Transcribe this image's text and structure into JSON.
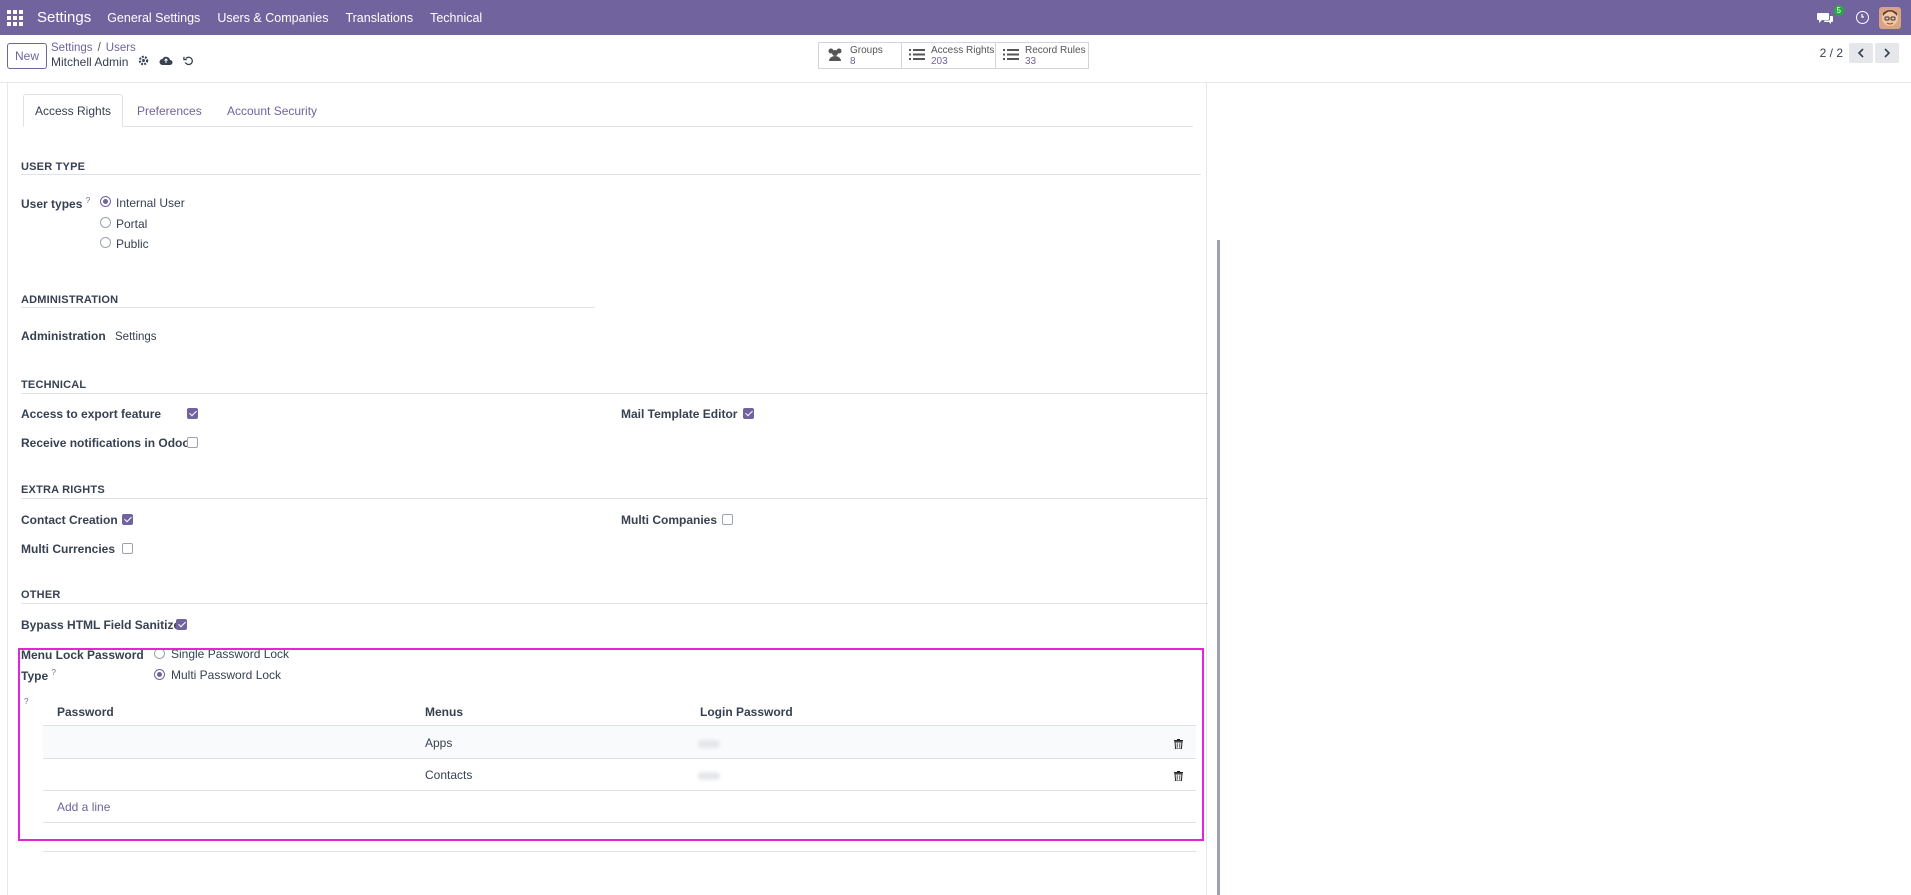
{
  "navbar": {
    "brand": "Settings",
    "menu": [
      "General Settings",
      "Users & Companies",
      "Translations",
      "Technical"
    ],
    "chat_count": "5"
  },
  "control_panel": {
    "new_label": "New",
    "breadcrumb": [
      "Settings",
      "Users"
    ],
    "record_name": "Mitchell Admin",
    "stats": [
      {
        "label": "Groups",
        "value": "8"
      },
      {
        "label": "Access Rights",
        "value": "203"
      },
      {
        "label": "Record Rules",
        "value": "33"
      }
    ],
    "pager": "2 / 2"
  },
  "tabs": [
    "Access Rights",
    "Preferences",
    "Account Security"
  ],
  "sections": {
    "user_type": {
      "title": "USER TYPE",
      "label": "User types",
      "options": [
        "Internal User",
        "Portal",
        "Public"
      ],
      "selected": "Internal User"
    },
    "administration": {
      "title": "ADMINISTRATION",
      "label": "Administration",
      "value": "Settings"
    },
    "technical": {
      "title": "TECHNICAL",
      "export": "Access to export feature",
      "notifications": "Receive notifications in Odoo",
      "mail_template": "Mail Template Editor"
    },
    "extra_rights": {
      "title": "EXTRA RIGHTS",
      "contact_creation": "Contact Creation",
      "multi_currencies": "Multi Currencies",
      "multi_companies": "Multi Companies"
    },
    "other": {
      "title": "OTHER",
      "bypass": "Bypass HTML Field Sanitize",
      "lock_label_1": "Menu Lock Password",
      "lock_label_2": "Type",
      "lock_options": [
        "Single Password Lock",
        "Multi Password Lock"
      ],
      "lock_selected": "Multi Password Lock"
    }
  },
  "password_table": {
    "headers": [
      "Password",
      "Menus",
      "Login Password"
    ],
    "rows": [
      {
        "menu": "Apps"
      },
      {
        "menu": "Contacts"
      }
    ],
    "add_line": "Add a line"
  },
  "colors": {
    "brand": "#71639e",
    "highlight": "#e424d8"
  }
}
